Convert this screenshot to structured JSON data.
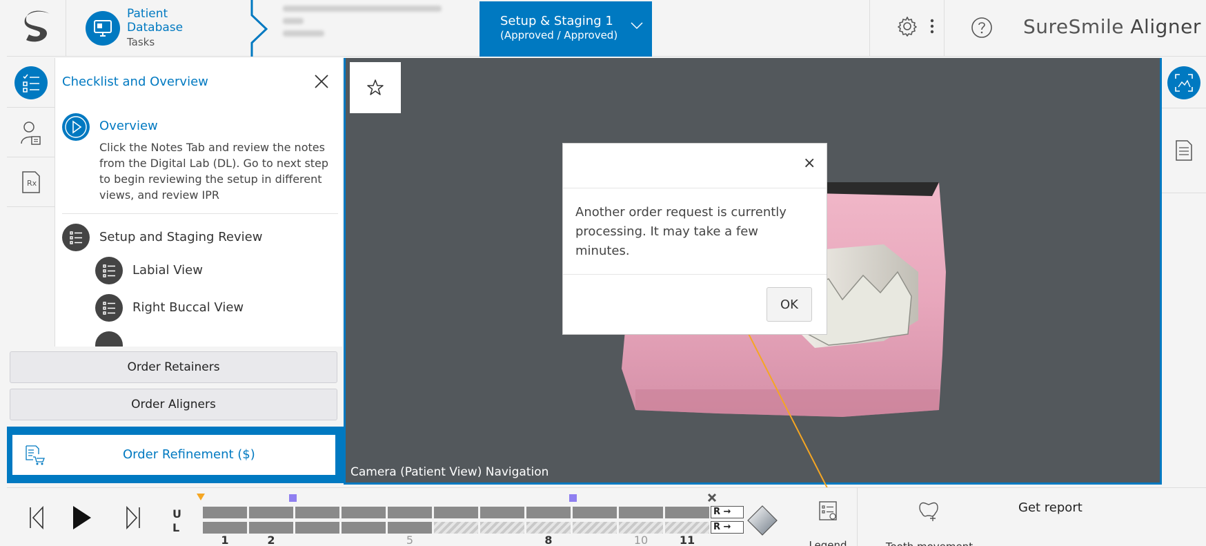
{
  "header": {
    "patient_db": {
      "title_line1": "Patient",
      "title_line2": "Database",
      "subtitle": "Tasks"
    },
    "stage_tab": {
      "line1": "Setup & Staging 1",
      "line2": "(Approved / Approved)"
    },
    "brand": {
      "part1": "SureSmile",
      "part2": "Aligner"
    },
    "accent_color": "#0079c1"
  },
  "checklist": {
    "title": "Checklist and Overview",
    "overview": {
      "label": "Overview",
      "description": "Click the Notes Tab and review the notes from the Digital Lab (DL). Go to next step to begin reviewing the setup in different views, and review IPR"
    },
    "setup_review": {
      "label": "Setup and Staging Review"
    },
    "sub_steps": [
      {
        "label": "Labial View"
      },
      {
        "label": "Right Buccal View"
      }
    ]
  },
  "orders": {
    "retainers": "Order Retainers",
    "aligners": "Order Aligners",
    "refinement": "Order Refinement ($)"
  },
  "viewport": {
    "camera_label": "Camera (Patient View) Navigation"
  },
  "dialog": {
    "message": "Another order request is currently processing. It may take a few minutes.",
    "ok_label": "OK",
    "close_glyph": "×"
  },
  "timeline": {
    "upper_label": "U",
    "lower_label": "L",
    "tick_labels": [
      {
        "text": "1"
      },
      {
        "text": "2"
      },
      {
        "text": "5"
      },
      {
        "text": "8"
      },
      {
        "text": "10"
      },
      {
        "text": "11"
      }
    ],
    "r_label": "R →",
    "legend_label": "Legend",
    "tooth_movement_label": "Tooth movement",
    "get_report_label": "Get report"
  }
}
